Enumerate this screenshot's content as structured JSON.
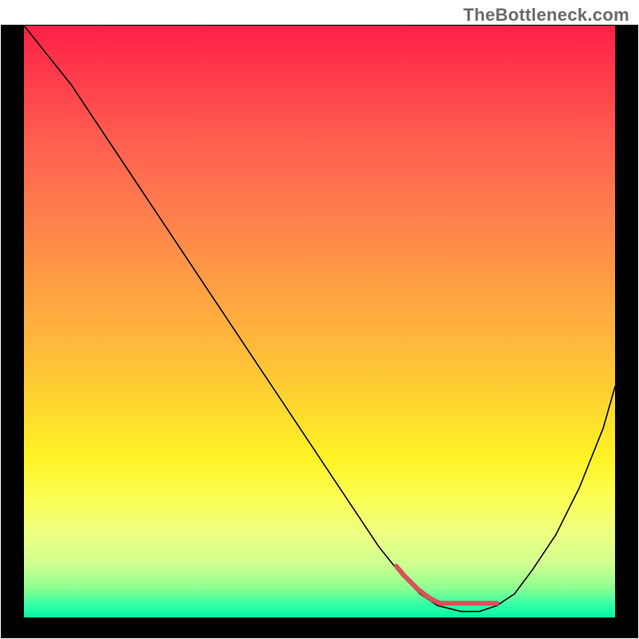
{
  "watermark": "TheBottleneck.com",
  "colors": {
    "gradient_top": "#ff1f47",
    "gradient_mid": "#fed72f",
    "gradient_bottom": "#07f5a4",
    "frame": "#000000",
    "curve": "#000000",
    "lobe": "#d6525a"
  },
  "chart_data": {
    "type": "line",
    "title": "",
    "xlabel": "",
    "ylabel": "",
    "xlim": [
      0,
      100
    ],
    "ylim": [
      0,
      100
    ],
    "x": [
      0,
      4,
      8,
      12,
      16,
      20,
      24,
      28,
      32,
      36,
      40,
      44,
      48,
      52,
      56,
      60,
      64,
      67,
      70,
      74,
      77,
      80,
      83,
      86,
      90,
      94,
      98,
      100
    ],
    "y": [
      100,
      95,
      90,
      84,
      78,
      72,
      66,
      60,
      54,
      48,
      42,
      36,
      30,
      24,
      18,
      12,
      7,
      4,
      2,
      1,
      1,
      2,
      4,
      8,
      14,
      22,
      32,
      39
    ],
    "series": [
      {
        "name": "bottleneck-curve",
        "x": "shared",
        "y": "shared"
      }
    ],
    "annotations": [
      {
        "name": "optimal-zone-lobe",
        "x_range": [
          63,
          80
        ],
        "y_approx": 2,
        "style": "thick-red-segment"
      }
    ]
  }
}
